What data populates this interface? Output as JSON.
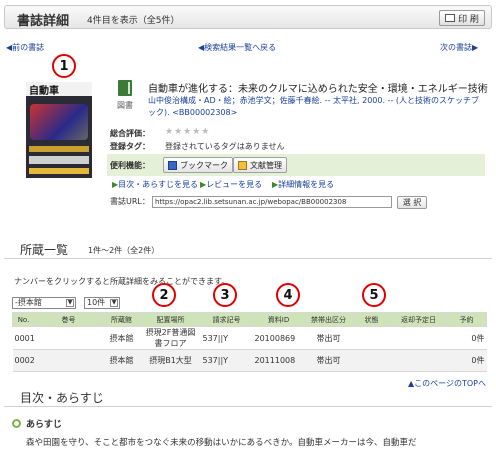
{
  "header": {
    "title": "書誌詳細",
    "count": "4件目を表示（全5件）",
    "print_label": "印 刷"
  },
  "nav": {
    "prev": "前の書誌",
    "back": "検索結果一覧へ戻る",
    "next": "次の書誌"
  },
  "book": {
    "type_label": "図書",
    "title": "自動車が進化する：未来のクルマに込められた安全・環境・エネルギー技術",
    "description": "山中俊治構成・AD・絵；赤池学文；佐藤千春絵. -- 太平社, 2000. -- (人と技術のスケッチブック). <BB00002308>",
    "cover_title": "自動車"
  },
  "fields": {
    "rating_label": "総合評価：",
    "rating_stars": "★★★★★",
    "tags_label": "登録タグ：",
    "tags_value": "登録されているタグはありません",
    "conv_label": "便利機能：",
    "bookmark_label": "ブックマーク",
    "docmanage_label": "文献管理"
  },
  "links": {
    "toc": "目次・あらすじを見る",
    "review": "レビューを見る",
    "detail": "詳細情報を見る"
  },
  "url": {
    "label": "書誌URL：",
    "value": "https://opac2.lib.setsunan.ac.jp/webopac/BB00002308",
    "select_label": "選 択"
  },
  "holdings": {
    "title": "所蔵一覧",
    "count": "1件～2件（全2件）",
    "note": "ナンバーをクリックすると所蔵詳細をみることができます。",
    "library_select": "-摂本館",
    "perpage_select": "10件",
    "columns": [
      "No.",
      "巻号",
      "所蔵館",
      "配置場所",
      "請求記号",
      "資料ID",
      "禁帯出区分",
      "状態",
      "返却予定日",
      "予約"
    ],
    "rows": [
      [
        "0001",
        "",
        "摂本館",
        "摂現2F普通図書フロア",
        "537||Y",
        "20100869",
        "帯出可",
        "",
        "",
        "0件"
      ],
      [
        "0002",
        "",
        "摂本館",
        "摂現B1大型",
        "537||Y",
        "20111008",
        "帯出可",
        "",
        "",
        "0件"
      ]
    ],
    "totop": "このページのTOPへ"
  },
  "toc": {
    "title": "目次・あらすじ",
    "subtitle": "あらすじ",
    "text": "森や田園を守り、そこと都市をつなぐ未来の移動はいかにあるべきか。自動車メーカーは今、自動車だ"
  },
  "annotations": [
    "1",
    "2",
    "3",
    "4",
    "5"
  ],
  "colors": {
    "accent_link": "#1a3f9c",
    "table_header": "#cfe3b8",
    "convenience_bg": "#e5f0d8",
    "marker": "#e00000"
  }
}
